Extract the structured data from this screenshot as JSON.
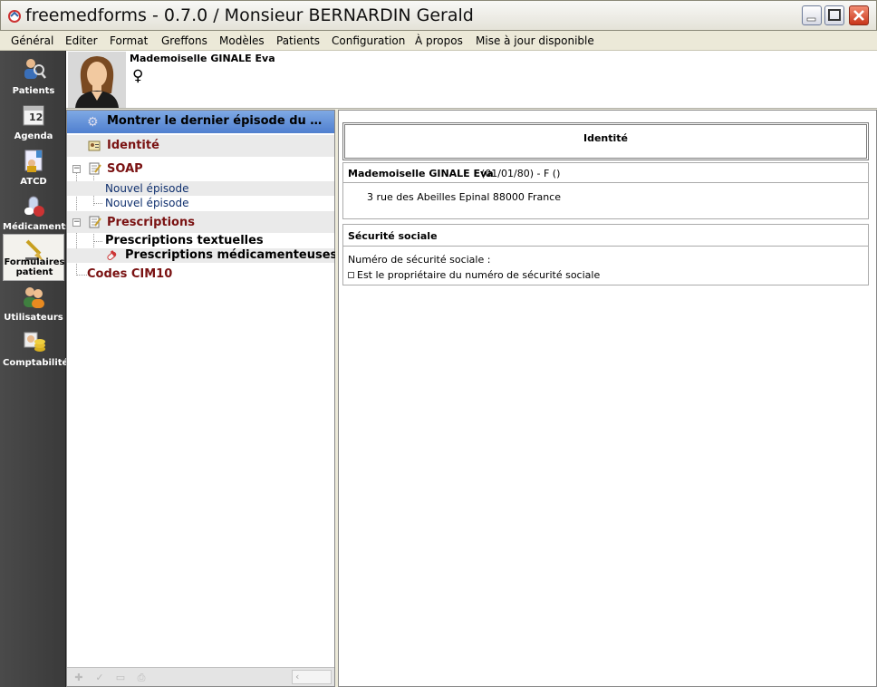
{
  "window": {
    "title": "freemedforms - 0.7.0 / Monsieur BERNARDIN Gerald"
  },
  "menu": [
    {
      "label": "Général"
    },
    {
      "label": "Editer"
    },
    {
      "label": "Format"
    },
    {
      "label": "Greffons"
    },
    {
      "label": "Modèles"
    },
    {
      "label": "Patients"
    },
    {
      "label": "Configuration"
    },
    {
      "label": "À propos"
    },
    {
      "label": "Mise à jour disponible"
    }
  ],
  "modes": [
    {
      "label": "Patients",
      "icon": "patients-icon"
    },
    {
      "label": "Agenda",
      "icon": "calendar-icon",
      "calendar_day": "12"
    },
    {
      "label": "ATCD",
      "icon": "atcd-icon"
    },
    {
      "label": "Médicaments",
      "icon": "drugs-icon"
    },
    {
      "label1": "Formulaires",
      "label2": "patient",
      "icon": "forms-icon",
      "active": true
    },
    {
      "label": "Utilisateurs",
      "icon": "users-icon"
    },
    {
      "label": "Comptabilité",
      "icon": "accounting-icon"
    }
  ],
  "patient": {
    "name": "Mademoiselle GINALE Eva",
    "gender_symbol": "♀"
  },
  "tree": {
    "header": "Montrer le dernier épisode du pa...",
    "identite": "Identité",
    "soap": "SOAP",
    "episode1": "Nouvel épisode",
    "episode2": "Nouvel épisode",
    "prescriptions": "Prescriptions",
    "presc_text": "Prescriptions textuelles",
    "presc_med": "Prescriptions médicamenteuses",
    "cim10": "Codes CIM10"
  },
  "form": {
    "title": "Identité",
    "patient_name": "Mademoiselle GINALE Eva",
    "patient_info": "(01/01/80) - F ()",
    "address": "3 rue des Abeilles Epinal 88000 France",
    "ss_title": "Sécurité sociale",
    "ss_number_label": "Numéro de sécurité sociale :",
    "ss_owner_label": "Est le propriétaire du numéro de sécurité sociale"
  },
  "colors": {
    "tree_header": "#5b89d6",
    "category_text": "#7a1212",
    "episode_text": "#10306e",
    "modebar": "#404040"
  }
}
